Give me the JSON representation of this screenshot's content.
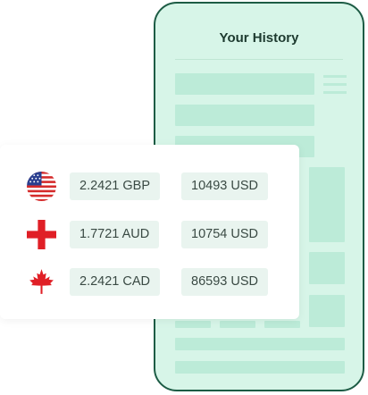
{
  "history": {
    "title": "Your History"
  },
  "conversions": [
    {
      "flag": "us-flag-icon",
      "rate": "2.2421 GBP",
      "amount": "10493 USD"
    },
    {
      "flag": "cross-flag-icon",
      "rate": "1.7721 AUD",
      "amount": "10754 USD"
    },
    {
      "flag": "canada-flag-icon",
      "rate": "2.2421 CAD",
      "amount": "86593 USD"
    }
  ],
  "colors": {
    "phone_border": "#1d5c45",
    "phone_fill": "#d7f5e8",
    "placeholder": "#bcebd8",
    "pill_fill": "#e9f4ef"
  }
}
